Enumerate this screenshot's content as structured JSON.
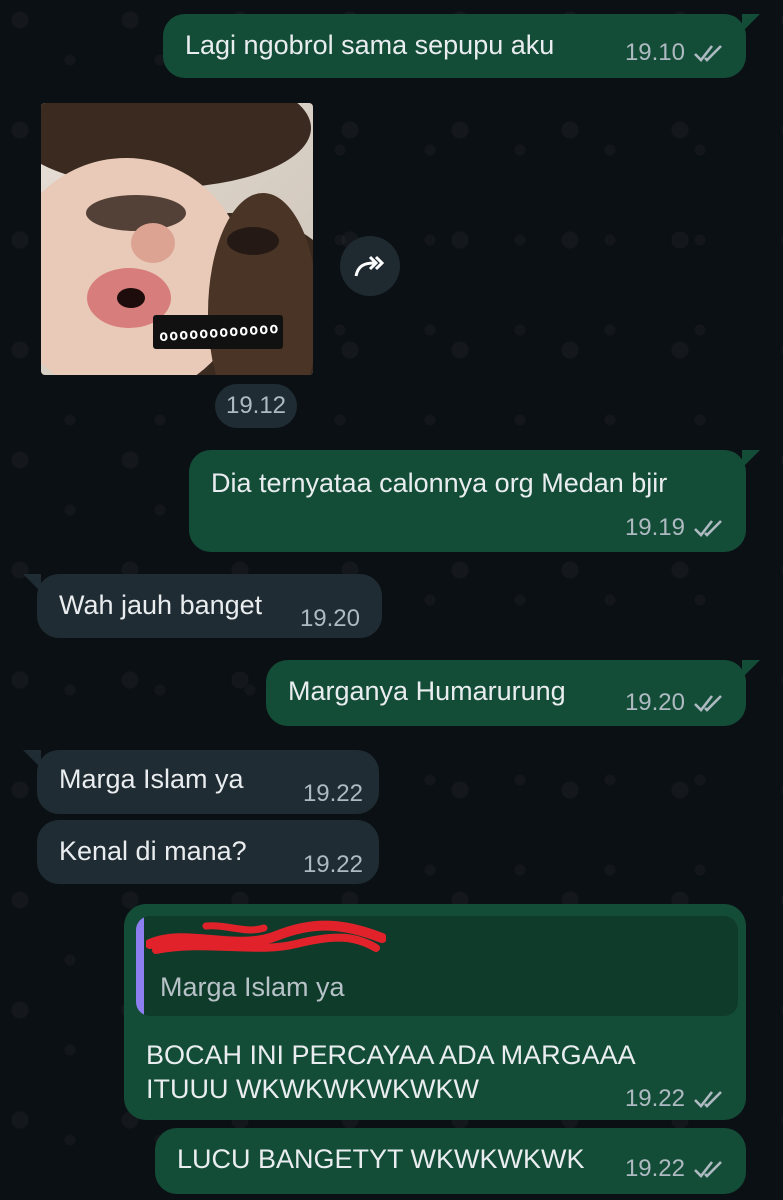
{
  "messages": [
    {
      "id": "m1",
      "direction": "out",
      "text": "Lagi ngobrol sama sepupu aku",
      "time": "19.10",
      "read": true
    },
    {
      "id": "m2",
      "direction": "in",
      "type": "sticker",
      "sticker_text": "oooooooooooo",
      "time": "19.12"
    },
    {
      "id": "m3",
      "direction": "out",
      "text": "Dia ternyataa calonnya org Medan bjir",
      "time": "19.19",
      "read": true
    },
    {
      "id": "m4",
      "direction": "in",
      "text": "Wah jauh banget",
      "time": "19.20"
    },
    {
      "id": "m5",
      "direction": "out",
      "text": "Marganya Humarurung",
      "time": "19.20",
      "read": true
    },
    {
      "id": "m6",
      "direction": "in",
      "text": "Marga Islam ya",
      "time": "19.22"
    },
    {
      "id": "m7",
      "direction": "in",
      "text": "Kenal di mana?",
      "time": "19.22"
    },
    {
      "id": "m8",
      "direction": "out",
      "quoted_text": "Marga Islam ya",
      "text_line1": "BOCAH INI PERCAYAA ADA MARGAAA",
      "text_line2": "ITUUU WKWKWKWKWKW",
      "time": "19.22",
      "read": true
    },
    {
      "id": "m9",
      "direction": "out",
      "text": "LUCU BANGETYT WKWKWKWK",
      "time": "19.22",
      "read": true
    }
  ],
  "colors": {
    "outgoing_bubble": "#144d37",
    "incoming_bubble": "#202c33",
    "background": "#0b1014",
    "quote_accent": "#8e7ff0",
    "redaction": "#e2222b"
  },
  "icons": {
    "read_receipt": "double-check-icon",
    "forward": "forward-arrow-icon"
  }
}
